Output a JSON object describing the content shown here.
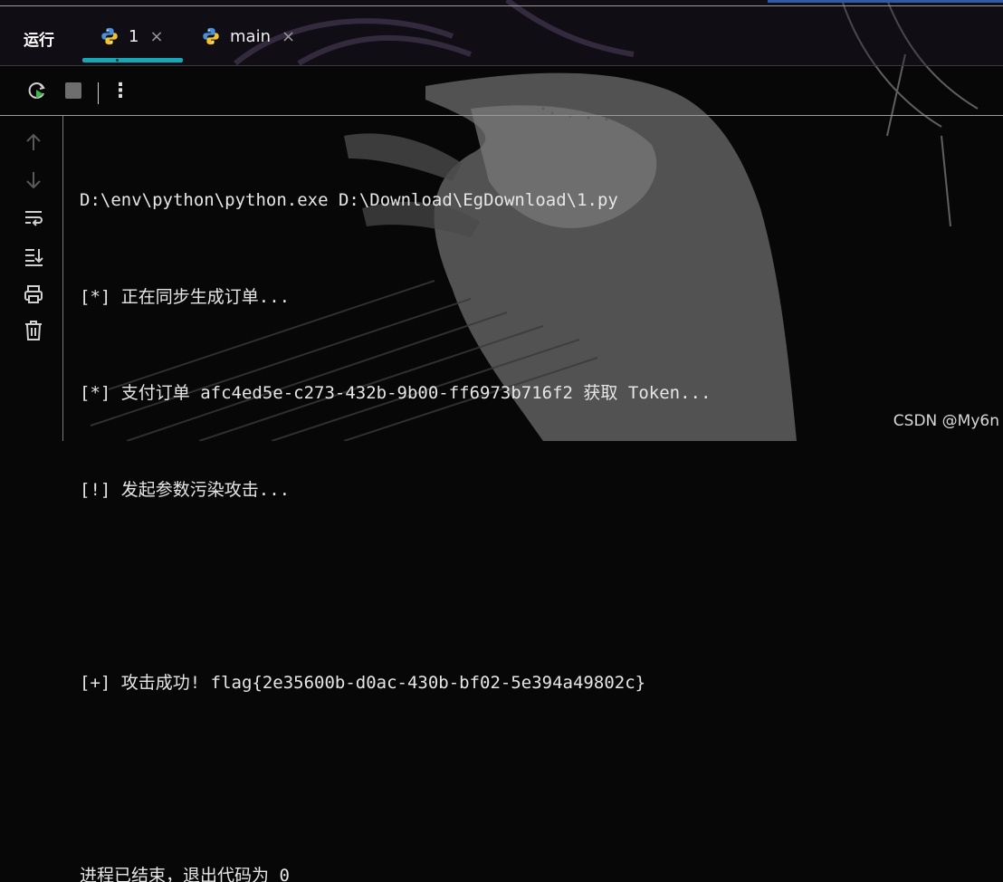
{
  "tool_window": {
    "title": "运行"
  },
  "tabs": [
    {
      "label": "1",
      "icon": "python-icon",
      "active": true
    },
    {
      "label": "main",
      "icon": "python-icon",
      "active": false
    }
  ],
  "close_glyph": "×",
  "toolbar": {
    "rerun": "rerun-icon",
    "stop": "stop-icon",
    "more": "⋮"
  },
  "gutter": [
    "arrow-up-icon",
    "arrow-down-icon",
    "soft-wrap-icon",
    "scroll-to-end-icon",
    "print-icon",
    "trash-icon"
  ],
  "console": {
    "lines": [
      "D:\\env\\python\\python.exe D:\\Download\\EgDownload\\1.py",
      "[*] 正在同步生成订单...",
      "[*] 支付订单 afc4ed5e-c273-432b-9b00-ff6973b716f2 获取 Token...",
      "[!] 发起参数污染攻击...",
      "",
      "[+] 攻击成功! flag{2e35600b-d0ac-430b-bf02-5e394a49802c}",
      "",
      "进程已结束，退出代码为 0"
    ]
  },
  "watermark": "CSDN @My6n",
  "colors": {
    "accent_tab": "#16a7b6",
    "text": "#e6e6e6",
    "background": "#070707"
  }
}
